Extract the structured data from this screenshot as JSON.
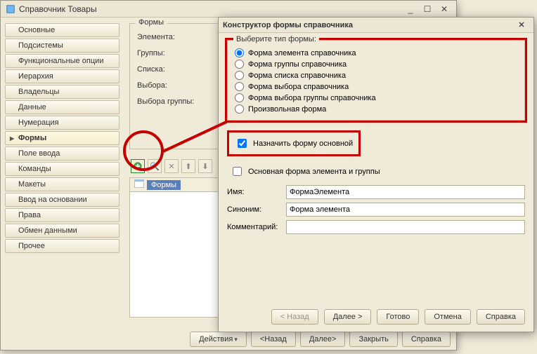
{
  "main_title": "Справочник Товары",
  "sidebar": {
    "items": [
      {
        "label": "Основные"
      },
      {
        "label": "Подсистемы"
      },
      {
        "label": "Функциональные опции"
      },
      {
        "label": "Иерархия"
      },
      {
        "label": "Владельцы"
      },
      {
        "label": "Данные"
      },
      {
        "label": "Нумерация"
      },
      {
        "label": "Формы",
        "active": true
      },
      {
        "label": "Поле ввода"
      },
      {
        "label": "Команды"
      },
      {
        "label": "Макеты"
      },
      {
        "label": "Ввод на основании"
      },
      {
        "label": "Права"
      },
      {
        "label": "Обмен данными"
      },
      {
        "label": "Прочее"
      }
    ]
  },
  "formy_group": {
    "legend": "Формы",
    "rows": [
      {
        "label": "Элемента:"
      },
      {
        "label": "Группы:"
      },
      {
        "label": "Списка:"
      },
      {
        "label": "Выбора:"
      },
      {
        "label": "Выбора группы:"
      }
    ]
  },
  "tree": {
    "header": "Формы"
  },
  "bottom_buttons": {
    "actions": "Действия",
    "back": "<Назад",
    "next": "Далее>",
    "close": "Закрыть",
    "help": "Справка"
  },
  "dialog": {
    "title": "Конструктор формы справочника",
    "form_type_legend": "Выберите тип формы:",
    "form_types": [
      {
        "label": "Форма элемента справочника",
        "selected": true
      },
      {
        "label": "Форма группы справочника"
      },
      {
        "label": "Форма списка справочника"
      },
      {
        "label": "Форма выбора справочника"
      },
      {
        "label": "Форма выбора группы справочника"
      },
      {
        "label": "Произвольная форма"
      }
    ],
    "assign_label": "Назначить форму основной",
    "assign_checked": true,
    "main_elem_label": "Основная форма элемента и группы",
    "main_elem_checked": false,
    "name_label": "Имя:",
    "name_value": "ФормаЭлемента",
    "synonym_label": "Синоним:",
    "synonym_value": "Форма элемента",
    "comment_label": "Комментарий:",
    "comment_value": "",
    "buttons": {
      "back": "< Назад",
      "next": "Далее >",
      "done": "Готово",
      "cancel": "Отмена",
      "help": "Справка"
    }
  }
}
